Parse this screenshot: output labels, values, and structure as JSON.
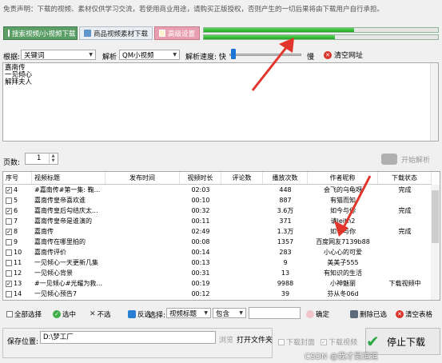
{
  "disclaimer": "免责声明：下载的视频、素材仅供学习交流，若使用商业用途，请购买正版授权，否则产生的一切后果将由下载用户自行承担。",
  "top_buttons": {
    "download_mode": "搜索视频/小视频下载",
    "material_download": "商品视频素材下载",
    "advanced": "高级设置"
  },
  "progress": {
    "bar1": 0.64,
    "bar2": 0.56
  },
  "filters": {
    "basis_label": "根据:",
    "basis_value": "关键词",
    "parse_label": "解析",
    "platform_value": "QM小视频",
    "speed_label": "解析速度: 快",
    "speed_level": 0.02,
    "slow_label": "慢",
    "clear_url": "清空网址"
  },
  "keywords": [
    "嘉南传",
    "一见倾心",
    "解拜夫人"
  ],
  "pages": {
    "label": "页数:",
    "value": "1"
  },
  "start_parse": "开始解析",
  "table": {
    "headers": [
      "序号",
      "视频标题",
      "发布时间",
      "视频时长",
      "评论数",
      "播放次数",
      "作者昵称",
      "下载状态"
    ],
    "rows": [
      {
        "checked": true,
        "no": "4",
        "title": "#嘉南传#第一集: 鞠...",
        "time": "",
        "duration": "02:03",
        "comments": "",
        "plays": "448",
        "author": "会飞的乌龟呀",
        "status": "完成",
        "selected": false
      },
      {
        "checked": false,
        "no": "5",
        "title": "嘉南传皇帝喜欢谁",
        "time": "",
        "duration": "00:10",
        "comments": "",
        "plays": "887",
        "author": "有猫而知",
        "status": "",
        "selected": false
      },
      {
        "checked": true,
        "no": "6",
        "title": "嘉南传皇后勾结庆太...",
        "time": "",
        "duration": "00:32",
        "comments": "",
        "plays": "3.6万",
        "author": "如今与你",
        "status": "完成",
        "selected": false
      },
      {
        "checked": false,
        "no": "7",
        "title": "嘉南传皇帝是谁演的",
        "time": "",
        "duration": "00:11",
        "comments": "",
        "plays": "371",
        "author": "请leith2",
        "status": "",
        "selected": false
      },
      {
        "checked": true,
        "no": "8",
        "title": "嘉南传",
        "time": "",
        "duration": "02:49",
        "comments": "",
        "plays": "1.3万",
        "author": "如今与你",
        "status": "完成",
        "selected": false
      },
      {
        "checked": false,
        "no": "9",
        "title": "嘉南传在哪里拍的",
        "time": "",
        "duration": "00:08",
        "comments": "",
        "plays": "1357",
        "author": "百度网友7139b88",
        "status": "",
        "selected": false
      },
      {
        "checked": false,
        "no": "10",
        "title": "嘉南传评价",
        "time": "",
        "duration": "00:14",
        "comments": "",
        "plays": "283",
        "author": "小心心的可爱",
        "status": "",
        "selected": false
      },
      {
        "checked": false,
        "no": "11",
        "title": "一见倾心一天更新几集",
        "time": "",
        "duration": "00:13",
        "comments": "",
        "plays": "9",
        "author": "美美子555",
        "status": "",
        "selected": false
      },
      {
        "checked": false,
        "no": "12",
        "title": "一见倾心背景",
        "time": "",
        "duration": "00:31",
        "comments": "",
        "plays": "13",
        "author": "有知识的生活",
        "status": "",
        "selected": false
      },
      {
        "checked": true,
        "no": "13",
        "title": "#一见倾心#光耀为救...",
        "time": "",
        "duration": "00:19",
        "comments": "",
        "plays": "9988",
        "author": "小神魅丽",
        "status": "下载视频中",
        "selected": false
      },
      {
        "checked": false,
        "no": "14",
        "title": "一见倾心预告7",
        "time": "",
        "duration": "00:12",
        "comments": "",
        "plays": "39",
        "author": "芬从冬06d",
        "status": "",
        "selected": false
      }
    ]
  },
  "bottom": {
    "select_all": "全部选择",
    "select": "选中",
    "deselect": "不选",
    "invert": "反选",
    "choose_label": "选择:",
    "field_value": "视频标题",
    "match_value": "包含",
    "confirm": "确定",
    "delete_selected": "删除已选",
    "clear_table": "清空表格"
  },
  "save": {
    "label": "保存位置:",
    "path": "D:\\梦工厂",
    "browse": "浏览",
    "open_folder": "打开文件夹",
    "download_cover": "下载封面",
    "download_video": "下载视频",
    "stop_download": "停止下载"
  },
  "watermark": "CSDN @我才是逗逗",
  "colors": {
    "accent_green": "#3fae49",
    "arrow_red": "#e2352c",
    "selection_blue": "#0a64d8"
  }
}
